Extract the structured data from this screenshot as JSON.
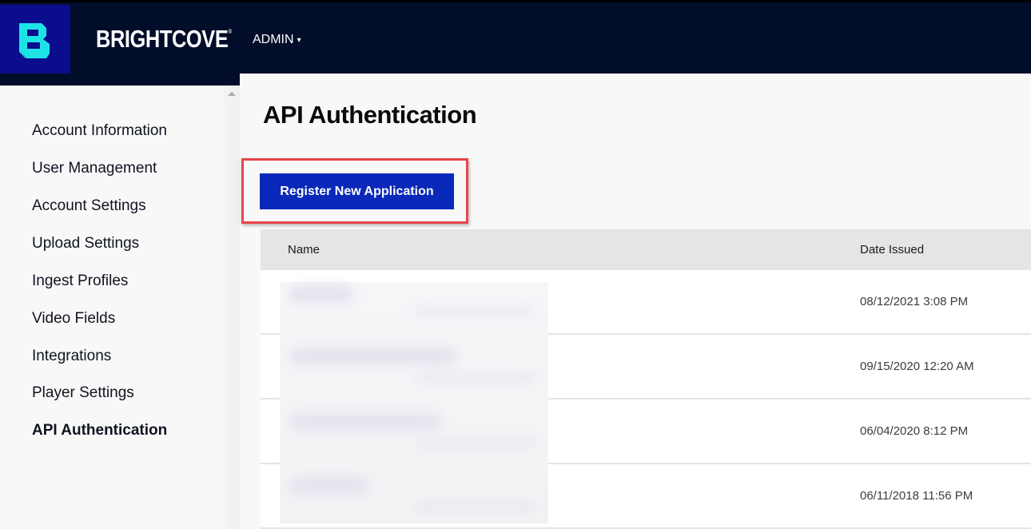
{
  "header": {
    "brand": "BRIGHTCOVE",
    "brand_mark": "®",
    "logo_icon": "brightcove-b-logo-icon",
    "menu_label": "ADMIN",
    "menu_caret": "▾"
  },
  "sidebar": {
    "items": [
      {
        "label": "Account Information",
        "active": false
      },
      {
        "label": "User Management",
        "active": false
      },
      {
        "label": "Account Settings",
        "active": false
      },
      {
        "label": "Upload Settings",
        "active": false
      },
      {
        "label": "Ingest Profiles",
        "active": false
      },
      {
        "label": "Video Fields",
        "active": false
      },
      {
        "label": "Integrations",
        "active": false
      },
      {
        "label": "Player Settings",
        "active": false
      },
      {
        "label": "API Authentication",
        "active": true
      }
    ]
  },
  "main": {
    "title": "API Authentication",
    "register_button": "Register New Application",
    "table": {
      "columns": [
        "Name",
        "Date Issued"
      ],
      "rows": [
        {
          "name": "",
          "date_issued": "08/12/2021 3:08 PM"
        },
        {
          "name": "",
          "date_issued": "09/15/2020 12:20 AM"
        },
        {
          "name": "",
          "date_issued": "06/04/2020 8:12 PM"
        },
        {
          "name": "",
          "date_issued": "06/11/2018 11:56 PM"
        }
      ]
    }
  },
  "colors": {
    "topbar": "#020d2a",
    "logo_bg": "#0a0d8c",
    "logo_fg": "#1de3e6",
    "button": "#0a28b9",
    "highlight": "#e8454a"
  }
}
